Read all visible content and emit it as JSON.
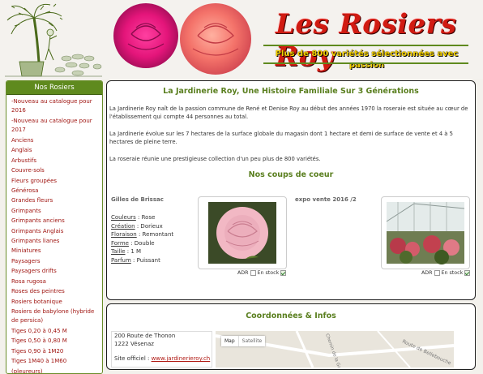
{
  "site": {
    "brand": "Les Rosiers Roy",
    "tagline": "Plus de 800 variétés sélectionnées avec passion"
  },
  "sidebar": {
    "title": "Nos Rosiers",
    "items": [
      "-Nouveau au catalogue pour 2016",
      "-Nouveau au catalogue pour 2017",
      "Anciens",
      "Anglais",
      "Arbustifs",
      "Couvre-sols",
      "Fleurs groupées",
      "Générosa",
      "Grandes fleurs",
      "Grimpants",
      "Grimpants anciens",
      "Grimpants Anglais",
      "Grimpants lianes",
      "Miniatures",
      "Paysagers",
      "Paysagers drifts",
      "Rosa rugosa",
      "Roses des peintres",
      "Rosiers botanique",
      "Rosiers de babylone (hybride de persica)",
      "Tiges 0,20 à 0,45 M",
      "Tiges 0,50 à 0,80 M",
      "Tiges 0,90 à 1M20",
      "Tiges 1M40 à 1M60 (pleureurs)"
    ]
  },
  "main": {
    "title": "La Jardinerie Roy, Une Histoire Familiale Sur 3 Générations",
    "para1": "La Jardinerie Roy naît de la passion commune de René et Denise Roy au début des années 1970 la roseraie est située au cœur de l'établissement qui compte 44 personnes au total.",
    "para2": "La Jardinerie évolue sur les 7 hectares de la surface globale du magasin dont 1 hectare et demi de surface de vente et 4 à 5 hectares de pleine terre.",
    "para3": "La roseraie réunie une prestigieuse collection d'un peu plus de 800 variétés.",
    "favorites_title": "Nos coups de coeur",
    "product1": {
      "name": "Gilles de Brissac",
      "couleurs_k": "Couleurs",
      "couleurs_v": " : Rose",
      "creation_k": "Création",
      "creation_v": " : Dorieux",
      "floraison_k": "Floraison",
      "floraison_v": " : Remontant",
      "forme_k": "Forme",
      "forme_v": " : Double",
      "taille_k": "Taille",
      "taille_v": " : 1 M",
      "parfum_k": "Parfum",
      "parfum_v": " : Puissant",
      "adr": "ADR",
      "stock": "En stock"
    },
    "product2": {
      "name": "expo vente 2016 /2",
      "adr": "ADR",
      "stock": "En stock"
    }
  },
  "contact": {
    "title": "Coordonnées & Infos",
    "address1": "200 Route de Thonon",
    "address2": "1222 Vésenaz",
    "site_label": "Site officiel : ",
    "site_url": "www.jardinerieroy.ch",
    "map_tab": "Map",
    "satellite_tab": "Satellite",
    "street1": "Route de Bellebouche",
    "street2": "Chemin de la Gabiule"
  },
  "colors": {
    "accent_green": "#5f8a1e",
    "link_red": "#a01612",
    "brand_red": "#d11b12"
  }
}
